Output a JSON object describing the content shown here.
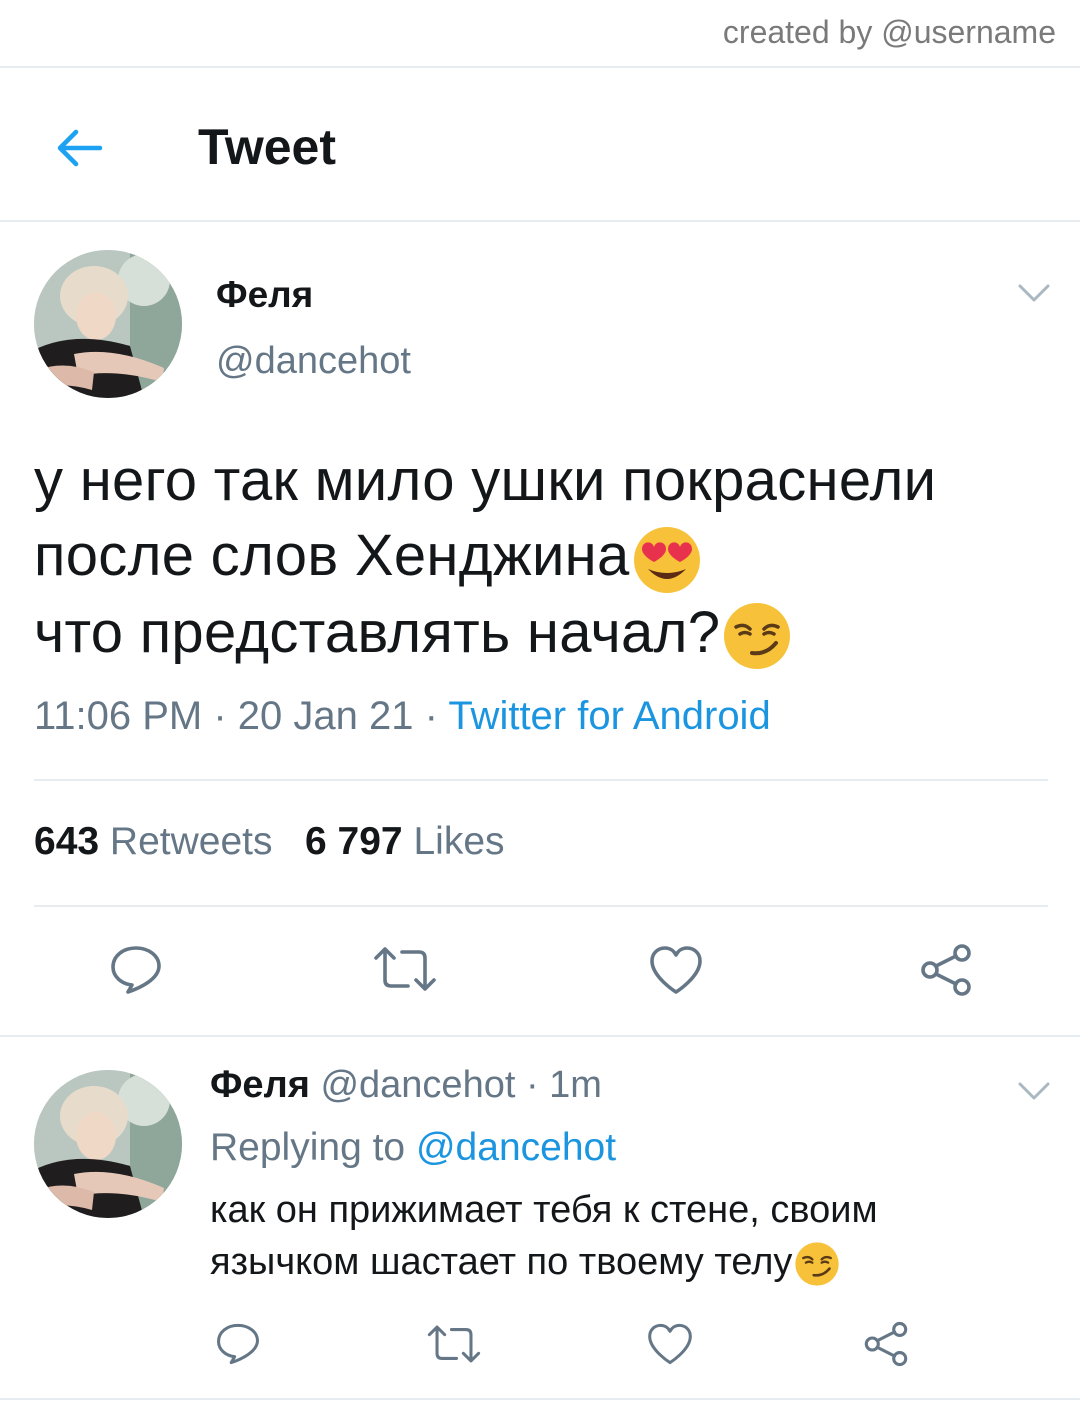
{
  "watermark": {
    "text": "created by @username"
  },
  "header": {
    "title": "Tweet",
    "back_icon": "arrow-left-icon",
    "accent": "#1da1f2"
  },
  "tweet": {
    "author": {
      "name": "Феля",
      "handle": "@dancehot"
    },
    "text_lines": [
      "у него так мило ушки покраснели",
      "после слов Хенджина",
      "что представлять начал?"
    ],
    "emojis": [
      "heart-eyes-emoji",
      "smirk-emoji"
    ],
    "time": "11:06 PM",
    "date": "20 Jan 21",
    "source": "Twitter for Android",
    "retweets": {
      "count": "643",
      "label": "Retweets"
    },
    "likes": {
      "count": "6 797",
      "label": "Likes"
    },
    "actions": [
      "reply-icon",
      "retweet-icon",
      "like-icon",
      "share-icon"
    ]
  },
  "reply": {
    "author": {
      "name": "Феля",
      "handle": "@dancehot",
      "age": "1m"
    },
    "replying_label": "Replying to",
    "replying_to": "@dancehot",
    "text_lines": [
      "как он прижимает тебя к стене, своим",
      "язычком шастает по твоему телу"
    ],
    "actions": [
      "reply-icon",
      "retweet-icon",
      "like-icon",
      "share-icon"
    ]
  },
  "colors": {
    "link": "#1b95e0",
    "muted": "#657786",
    "divider": "#e6ecf0"
  }
}
